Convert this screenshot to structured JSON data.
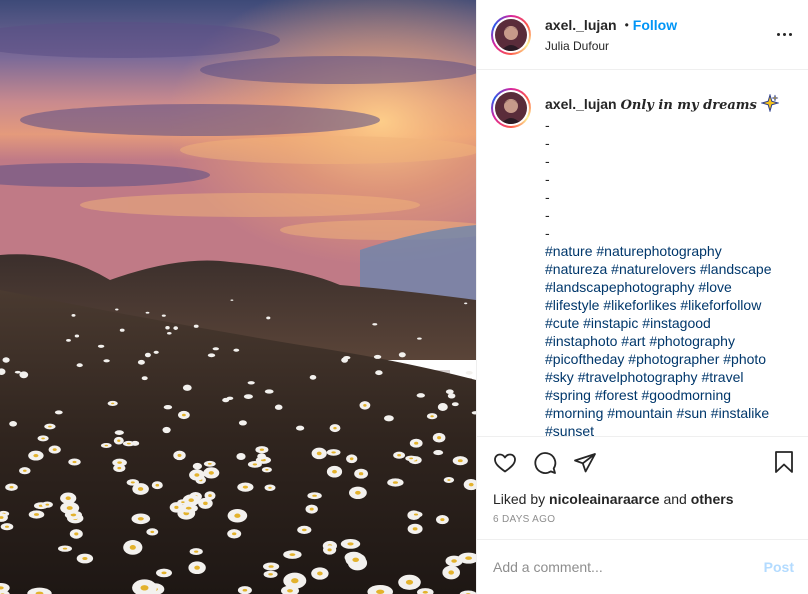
{
  "post": {
    "image_alt": "Sunset sky over a hill with a field of white daisies"
  },
  "header": {
    "username": "axel._lujan",
    "separator": "•",
    "follow_label": "Follow",
    "location": "Julia Dufour",
    "more_icon": "more-options-icon"
  },
  "caption": {
    "username": "axel._lujan",
    "title": "Only in my dreams",
    "emoji": "sparkles-icon",
    "dashes": [
      "-",
      "-",
      "-",
      "-",
      "-",
      "-",
      "-"
    ],
    "hashtag_lines": [
      [
        "#nature",
        "#naturephotography"
      ],
      [
        "#natureza",
        "#naturelovers",
        "#landscape"
      ],
      [
        "#landscapephotography",
        "#love"
      ],
      [
        "#lifestyle",
        "#likeforlikes",
        "#likeforfollow"
      ],
      [
        "#cute",
        "#instapic",
        "#instagood"
      ],
      [
        "#instaphoto",
        "#art",
        "#photography"
      ],
      [
        "#picoftheday",
        "#photographer",
        "#photo"
      ],
      [
        "#sky",
        "#travelphotography",
        "#travel"
      ],
      [
        "#spring",
        "#forest",
        "#goodmorning"
      ],
      [
        "#morning",
        "#mountain",
        "#sun",
        "#instalike"
      ],
      [
        "#sunset"
      ]
    ]
  },
  "actions": {
    "like_icon": "heart-icon",
    "comment_icon": "comment-icon",
    "share_icon": "share-icon",
    "save_icon": "bookmark-icon"
  },
  "likes": {
    "prefix": "Liked by",
    "user": "nicoleainaraarce",
    "joiner": "and",
    "others": "others"
  },
  "timestamp": "6 DAYS AGO",
  "comment_box": {
    "placeholder": "Add a comment...",
    "post_label": "Post"
  },
  "colors": {
    "accent": "#0095f6",
    "hashtag": "#00376b",
    "post_disabled": "#b3dbff",
    "muted": "#8e8e8e"
  }
}
